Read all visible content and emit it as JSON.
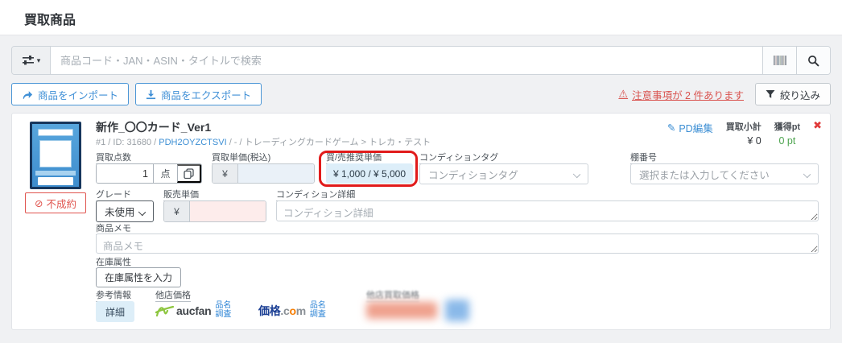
{
  "page": {
    "title": "買取商品"
  },
  "search": {
    "placeholder": "商品コード・JAN・ASIN・タイトルで検索"
  },
  "toolbar": {
    "import_label": "商品をインポート",
    "export_label": "商品をエクスポート",
    "warning_text": "注意事項が 2 件あります",
    "filter_label": "絞り込み"
  },
  "product": {
    "title": "新作_〇〇カード_Ver1",
    "meta_prefix": "#1 / ID: 31680 / ",
    "meta_link": "PDH2OYZCTSVI",
    "meta_suffix": " / - / トレーディングカードゲーム > トレカ・テスト",
    "pd_edit_label": "PD編集",
    "subtotal_label": "買取小計",
    "subtotal_value": "¥ 0",
    "points_label": "獲得pt",
    "points_value": "0 pt",
    "status_badge": "不成約"
  },
  "fields": {
    "quantity": {
      "label": "買取点数",
      "value": "1",
      "unit": "点"
    },
    "unit_price": {
      "label": "買取単価(税込)",
      "prefix": "¥"
    },
    "recommended_price": {
      "label": "買/売推奨単価",
      "value": "¥ 1,000 / ¥ 5,000"
    },
    "condition_tag": {
      "label": "コンディションタグ",
      "placeholder": "コンディションタグ"
    },
    "shelf": {
      "label": "棚番号",
      "placeholder": "選択または入力してください"
    },
    "grade": {
      "label": "グレード",
      "value": "未使用"
    },
    "sale_price": {
      "label": "販売単価",
      "prefix": "¥"
    },
    "condition_detail": {
      "label": "コンディション詳細",
      "placeholder": "コンディション詳細"
    },
    "memo": {
      "label": "商品メモ",
      "placeholder": "商品メモ"
    },
    "stock_attr": {
      "label": "在庫属性",
      "button_label": "在庫属性を入力"
    }
  },
  "reference": {
    "label": "参考情報",
    "detail_button": "詳細",
    "other_price_label": "他店価格",
    "aucfan": "aucfan",
    "kakaku_part1": "価格",
    "kakaku_dot_c": ".c",
    "kakaku_o": "o",
    "kakaku_m": "m",
    "research_line1": "品名",
    "research_line2": "調査",
    "other_buy_price_label": "他店買取価格"
  },
  "icons": {
    "close": "✖",
    "prohibited": "⊘",
    "pencil": "✎",
    "warning": "⚠",
    "caret_down": "▾"
  },
  "colors": {
    "accent_blue": "#3f8fd6",
    "annotation_red": "#e11b1b",
    "badge_red": "#e0544e",
    "points_green": "#4da44f",
    "light_blue_bg": "#ddeef9",
    "pink_bg": "#fdeceb"
  }
}
